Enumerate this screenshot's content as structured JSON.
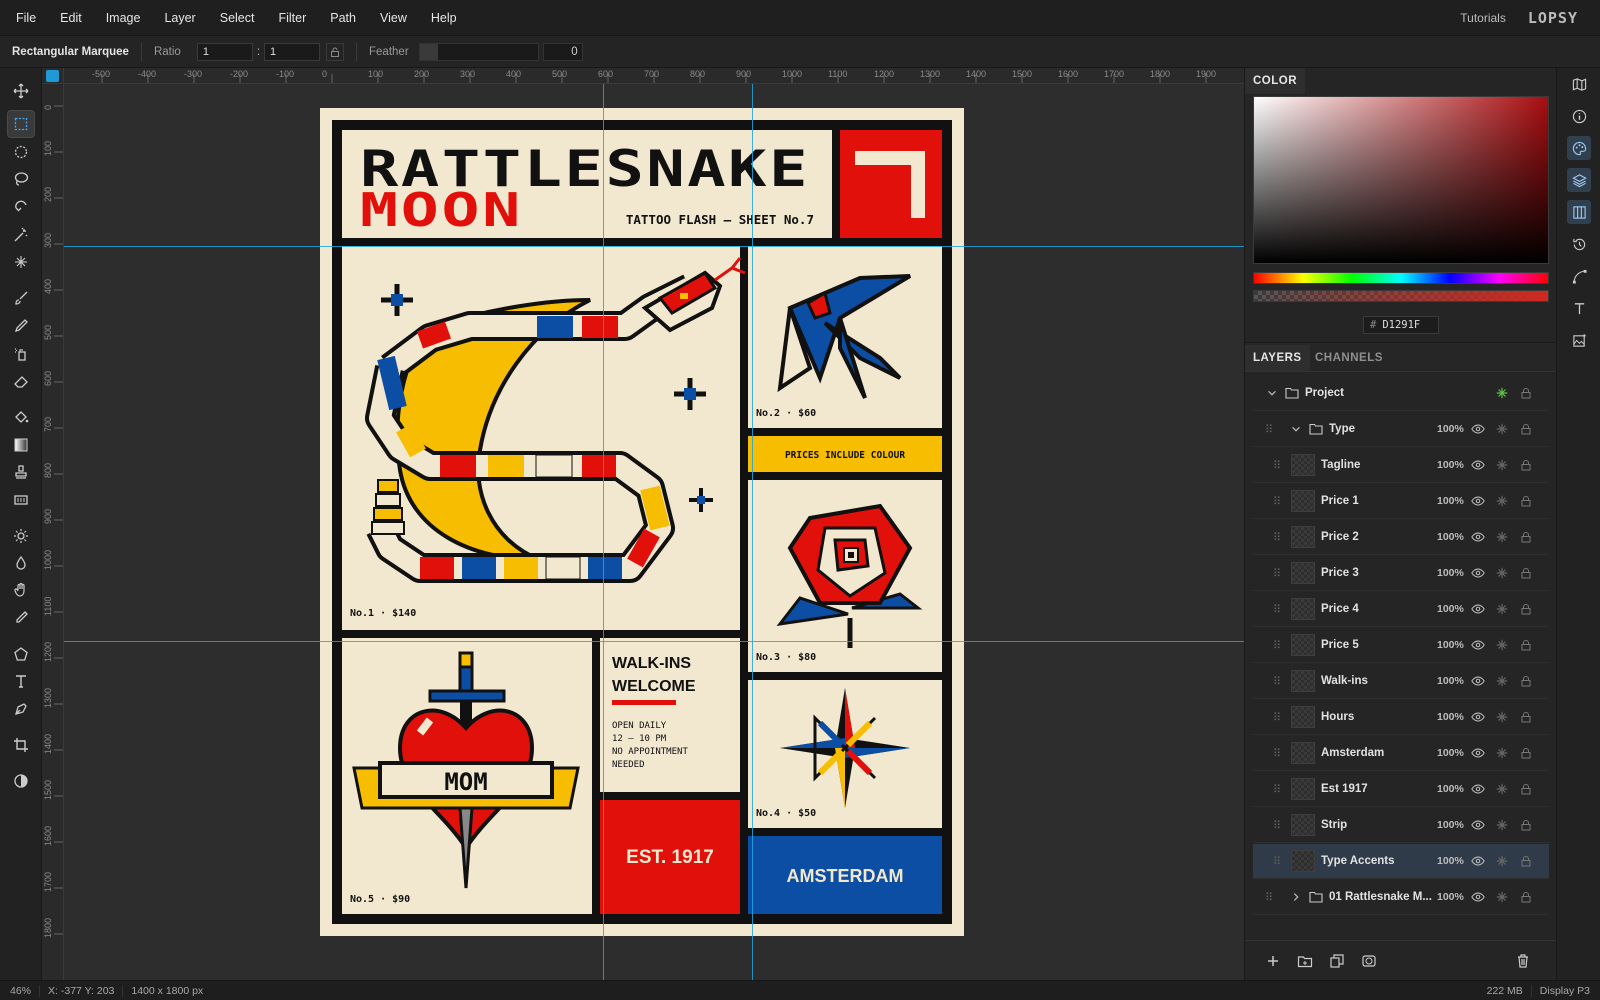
{
  "menubar": {
    "items": [
      "File",
      "Edit",
      "Image",
      "Layer",
      "Select",
      "Filter",
      "Path",
      "View",
      "Help"
    ],
    "tutorials": "Tutorials",
    "brand": "LOPSY"
  },
  "options": {
    "tool_name": "Rectangular Marquee",
    "ratio_label": "Ratio",
    "ratio_w": "1",
    "ratio_sep": ":",
    "ratio_h": "1",
    "feather_label": "Feather",
    "feather_value": "0"
  },
  "rulers": {
    "top_ticks": [
      "-500",
      "-400",
      "-300",
      "-200",
      "-100",
      "0",
      "100",
      "200",
      "300",
      "400",
      "500",
      "600",
      "700",
      "800",
      "900",
      "1000",
      "1100",
      "1200",
      "1300",
      "1400",
      "1500",
      "1600",
      "1700",
      "1800",
      "1900"
    ],
    "left_ticks": [
      "0",
      "100",
      "200",
      "300",
      "400",
      "500",
      "600",
      "700",
      "800",
      "900",
      "1000",
      "1100",
      "1200",
      "1300",
      "1400",
      "1500",
      "1600",
      "1700",
      "1800"
    ]
  },
  "poster": {
    "title_line1": "RATTLESNAKE",
    "title_line2": "MOON",
    "subtitle": "TATTOO FLASH — SHEET No.7",
    "price1": "No.1 · $140",
    "price2": "No.2 · $60",
    "price3": "No.3 · $80",
    "price4": "No.4 · $50",
    "price5": "No.5 · $90",
    "strip": "PRICES INCLUDE COLOUR",
    "walkins_1": "WALK-INS",
    "walkins_2": "WELCOME",
    "hours_1": "OPEN DAILY",
    "hours_2": "12 – 10 PM",
    "hours_3": "NO APPOINTMENT",
    "hours_4": "NEEDED",
    "est": "EST. 1917",
    "city": "AMSTERDAM",
    "banner": "MOM",
    "colors": {
      "red": "#e2100b",
      "yellow": "#f7bd00",
      "blue": "#0b4ea3",
      "cream": "#f2e7cf",
      "ink": "#111111"
    }
  },
  "color_panel": {
    "tab": "COLOR",
    "hex_prefix": "#",
    "hex": "D1291F"
  },
  "layers_panel": {
    "tab_layers": "LAYERS",
    "tab_channels": "CHANNELS",
    "rows": [
      {
        "name": "Project",
        "opacity": ""
      },
      {
        "name": "Type",
        "opacity": "100%"
      },
      {
        "name": "Tagline",
        "opacity": "100%"
      },
      {
        "name": "Price 1",
        "opacity": "100%"
      },
      {
        "name": "Price 2",
        "opacity": "100%"
      },
      {
        "name": "Price 3",
        "opacity": "100%"
      },
      {
        "name": "Price 4",
        "opacity": "100%"
      },
      {
        "name": "Price 5",
        "opacity": "100%"
      },
      {
        "name": "Walk-ins",
        "opacity": "100%"
      },
      {
        "name": "Hours",
        "opacity": "100%"
      },
      {
        "name": "Amsterdam",
        "opacity": "100%"
      },
      {
        "name": "Est 1917",
        "opacity": "100%"
      },
      {
        "name": "Strip",
        "opacity": "100%"
      },
      {
        "name": "Type Accents",
        "opacity": "100%"
      },
      {
        "name": "01 Rattlesnake M...",
        "opacity": "100%"
      }
    ]
  },
  "status": {
    "zoom": "46%",
    "coords": "X: -377 Y: 203",
    "size": "1400 x 1800 px",
    "memory": "222 MB",
    "profile": "Display P3"
  }
}
